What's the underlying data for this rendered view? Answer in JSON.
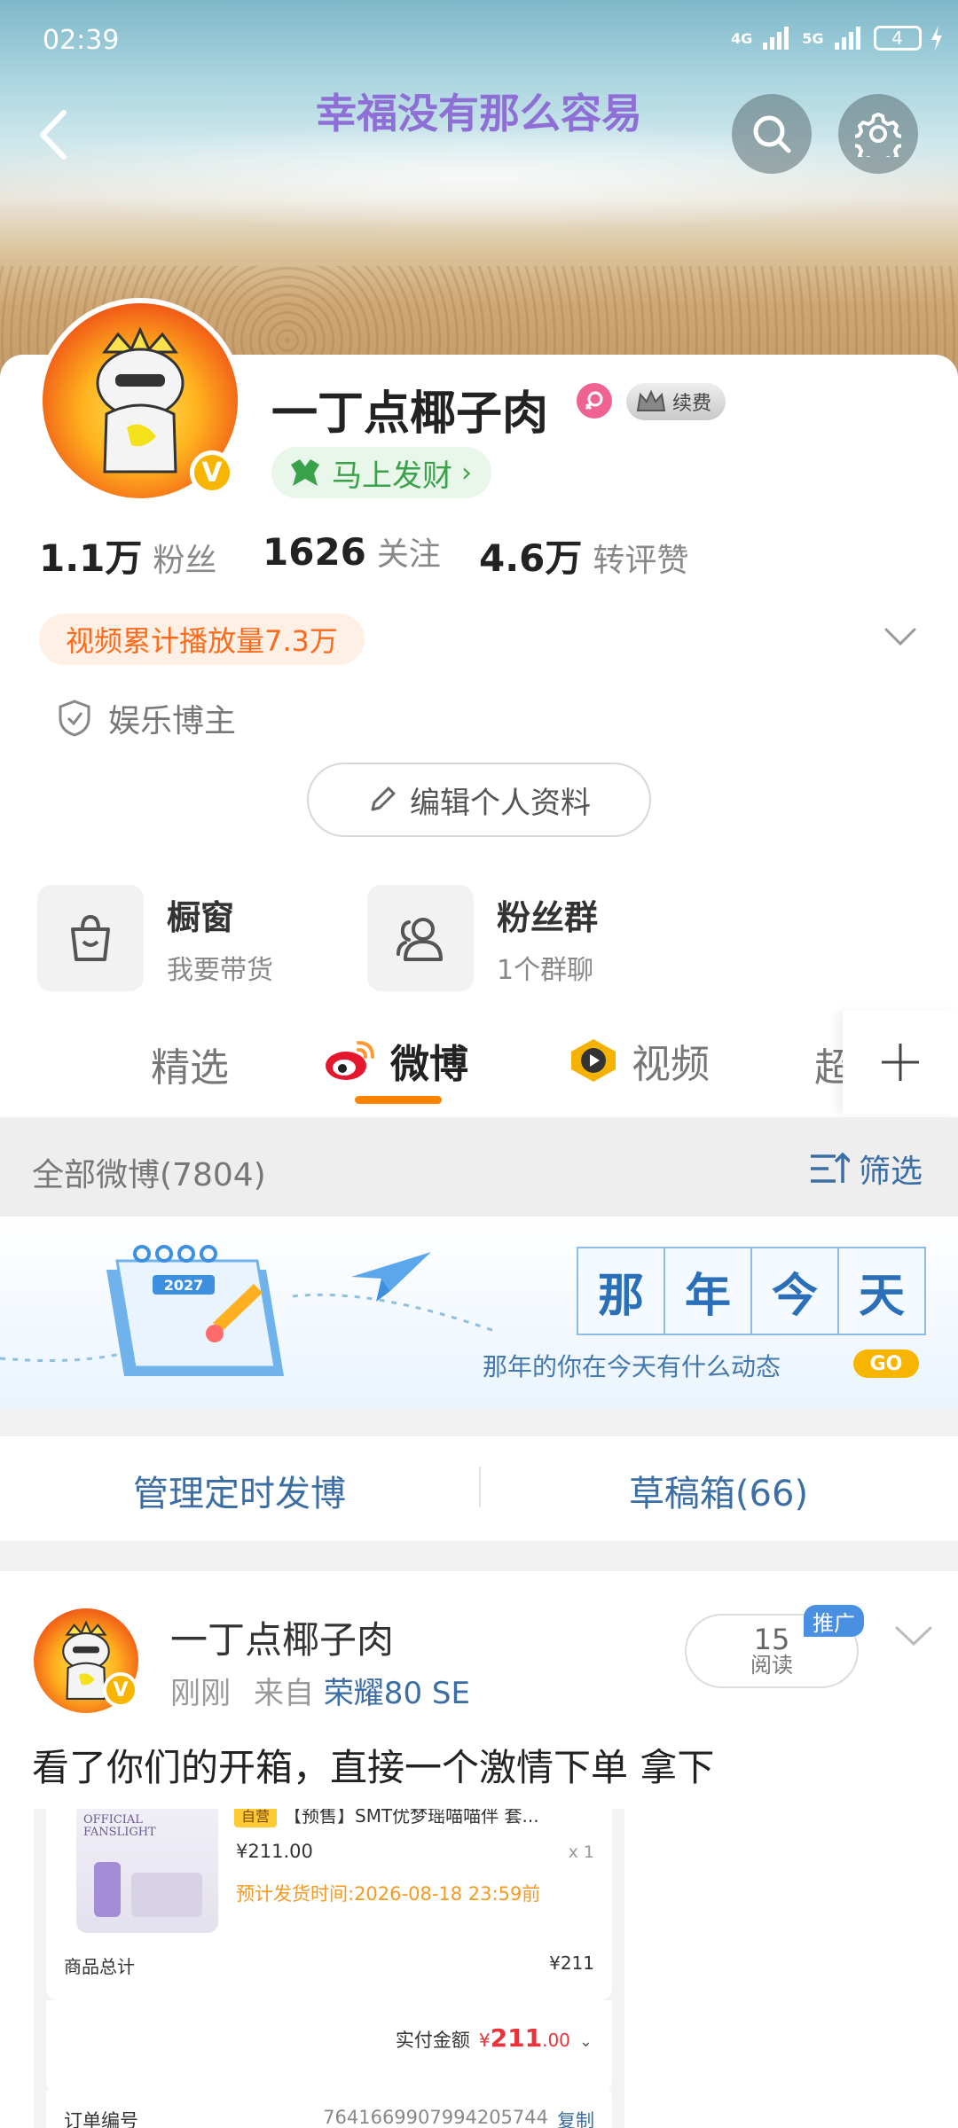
{
  "status_bar": {
    "time": "02:39",
    "net1": "4G",
    "net2": "5G",
    "battery": "4"
  },
  "header": {
    "title": "幸福没有那么容易"
  },
  "profile": {
    "name": "一丁点椰子肉",
    "vip_label": "续费",
    "fortune_label": "马上发财",
    "stats": [
      {
        "num": "1.1万",
        "label": "粉丝"
      },
      {
        "num": "1626",
        "label": "关注"
      },
      {
        "num": "4.6万",
        "label": "转评赞"
      }
    ],
    "video_plays": "视频累计播放量7.3万",
    "category": "娱乐博主",
    "edit_button": "编辑个人资料",
    "shortcuts": [
      {
        "title": "橱窗",
        "subtitle": "我要带货"
      },
      {
        "title": "粉丝群",
        "subtitle": "1个群聊"
      }
    ]
  },
  "tabs": {
    "items": [
      "精选",
      "微博",
      "视频",
      "超"
    ],
    "active": "微博"
  },
  "filter_bar": {
    "label": "全部微博(7804)",
    "filter": "筛选"
  },
  "banner": {
    "calendar_year": "2027",
    "title_chars": [
      "那",
      "年",
      "今",
      "天"
    ],
    "subtitle": "那年的你在今天有什么动态",
    "go": "GO"
  },
  "actions": {
    "schedule": "管理定时发博",
    "drafts": "草稿箱(66)"
  },
  "post": {
    "author": "一丁点椰子肉",
    "time": "刚刚",
    "source_prefix": "来自",
    "device": "荣耀80 SE",
    "reads_num": "15",
    "reads_label": "阅读",
    "promote": "推广",
    "text": "看了你们的开箱，直接一个激情下单 拿下",
    "order": {
      "tag": "自营",
      "item_title": "【预售】SMT优梦瑶喵喵伴 套...",
      "thumb_text": "OFFICIAL FANSLIGHT",
      "price": "¥211.00",
      "qty": "x 1",
      "ship": "预计发货时间:2026-08-18 23:59前",
      "total_label": "商品总计",
      "total_value": "¥211",
      "paid_label": "实付金额",
      "paid_currency": "¥",
      "paid_int": "211",
      "paid_dec": ".00",
      "order_no_label": "订单编号",
      "order_no": "7641669907994205744",
      "copy": "复制"
    }
  },
  "colors": {
    "accent_orange": "#ff8200",
    "link_blue": "#3b6ea5",
    "vip_gold": "#f7b500"
  }
}
